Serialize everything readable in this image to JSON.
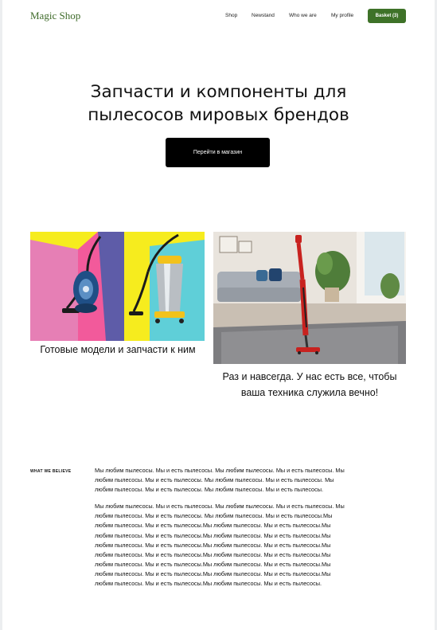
{
  "header": {
    "logo": "Magic Shop",
    "nav": [
      "Shop",
      "Newstand",
      "Who we are",
      "My profile"
    ],
    "basket": "Basket (3)"
  },
  "hero": {
    "title_lines": [
      "Запчасти и компоненты для",
      "пылесосов мировых брендов"
    ],
    "cta": "Перейти в магазин"
  },
  "gallery": {
    "left_caption": "Готовые модели и запчасти к ним",
    "right_caption_lines": [
      "Раз и навсегда. У нас есть все, чтобы",
      "ваша техника служила вечно!"
    ]
  },
  "believe": {
    "label": "WHAT WE BELIEVE",
    "paragraphs": [
      "Мы любим пылесосы. Мы и есть пылесосы. Мы любим пылесосы. Мы и есть пылесосы. Мы любим пылесосы. Мы и есть пылесосы. Мы любим пылесосы. Мы и есть пылесосы. Мы любим пылесосы. Мы и есть пылесосы. Мы любим пылесосы. Мы и есть пылесосы.",
      "Мы любим пылесосы. Мы и есть пылесосы. Мы любим пылесосы. Мы и есть пылесосы. Мы любим пылесосы. Мы и есть пылесосы. Мы любим пылесосы. Мы и есть пылесосы.Мы любим пылесосы. Мы и есть пылесосы.Мы любим пылесосы. Мы и есть пылесосы.Мы любим пылесосы. Мы и есть пылесосы.Мы любим пылесосы. Мы и есть пылесосы.Мы любим пылесосы. Мы и есть пылесосы.Мы любим пылесосы. Мы и есть пылесосы.Мы любим пылесосы. Мы и есть пылесосы.Мы любим пылесосы. Мы и есть пылесосы.Мы любим пылесосы. Мы и есть пылесосы.Мы любим пылесосы. Мы и есть пылесосы.Мы любим пылесосы. Мы и есть пылесосы.Мы любим пылесосы. Мы и есть пылесосы.Мы любим пылесосы. Мы и есть пылесосы.Мы любим пылесосы. Мы и есть пылесосы."
    ]
  },
  "colors": {
    "brand_green": "#3e7228",
    "logo_green": "#3f6b2a",
    "cta_black": "#000000"
  }
}
